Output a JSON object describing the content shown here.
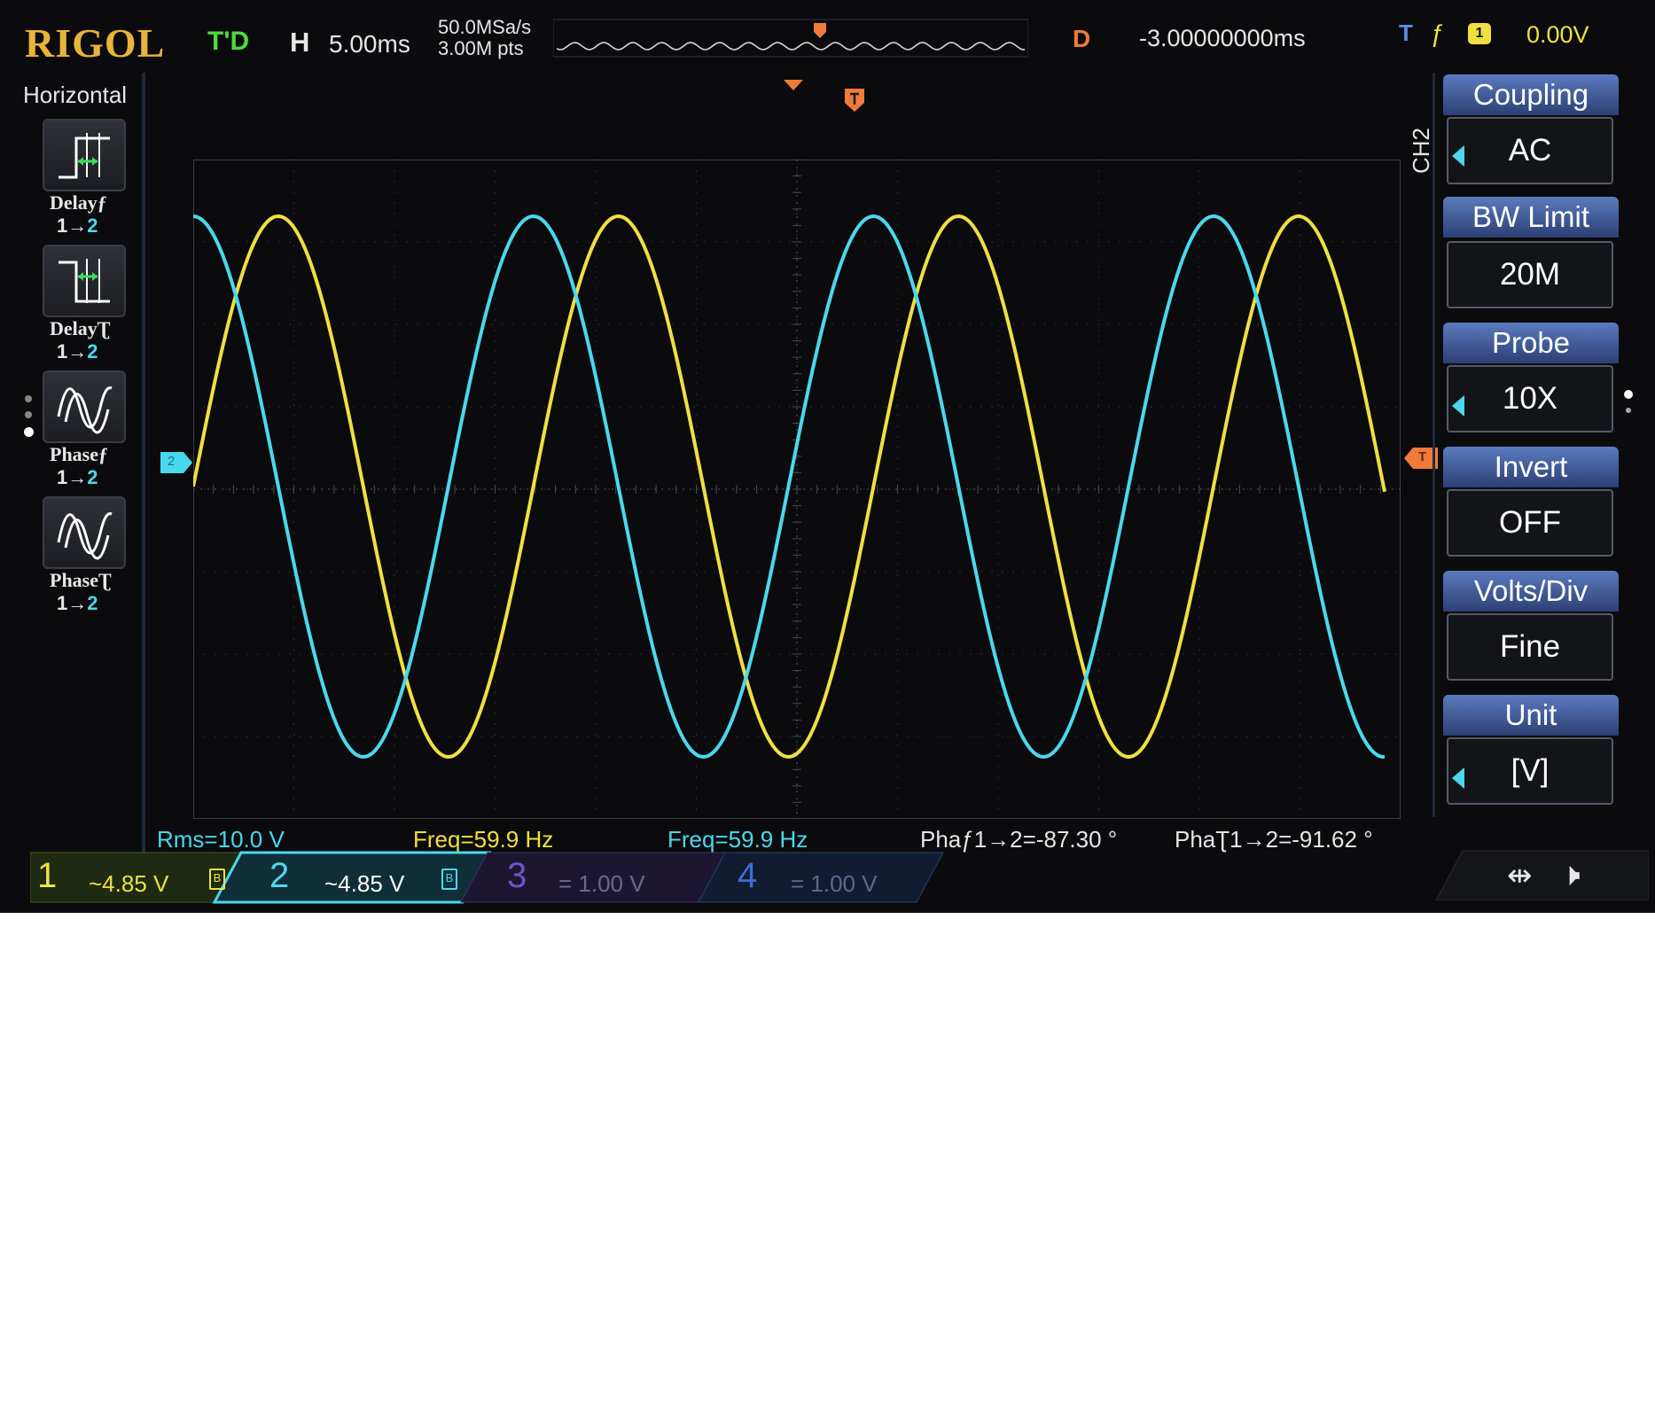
{
  "topbar": {
    "brand": "RIGOL",
    "run_state": "T'D",
    "horizontal_label": "H",
    "timebase": "5.00ms",
    "sample_rate": "50.0MSa/s",
    "memory_depth": "3.00M pts",
    "delay_label": "D",
    "delay_value": "-3.00000000ms",
    "trigger_label": "T",
    "trigger_source": "1",
    "trigger_level": "0.00V"
  },
  "left_menu": {
    "title": "Horizontal",
    "items": [
      {
        "label": "Delayƒ",
        "sub_a": "1→",
        "sub_b": "2"
      },
      {
        "label": "DelayƮ",
        "sub_a": "1→",
        "sub_b": "2"
      },
      {
        "label": "Phaseƒ",
        "sub_a": "1→",
        "sub_b": "2"
      },
      {
        "label": "PhaseƮ",
        "sub_a": "1→",
        "sub_b": "2"
      }
    ]
  },
  "right_menu": {
    "channel": "CH2",
    "items": [
      {
        "label": "Coupling",
        "value": "AC"
      },
      {
        "label": "BW Limit",
        "value": "20M"
      },
      {
        "label": "Probe",
        "value": "10X"
      },
      {
        "label": "Invert",
        "value": "OFF"
      },
      {
        "label": "Volts/Div",
        "value": "Fine"
      },
      {
        "label": "Unit",
        "value": "[V]"
      }
    ]
  },
  "markers": {
    "ch2_offset": "2",
    "trigger_level": "T"
  },
  "measurements": {
    "rms": "Rms=10.0 V",
    "freq1": "Freq=59.9 Hz",
    "freq2": "Freq=59.9 Hz",
    "phase_rise": "Phaƒ1→2=-87.30 °",
    "phase_fall": "PhaƮ1→2=-91.62 °"
  },
  "channels": [
    {
      "num": "1",
      "scale": "~4.85 V",
      "color": "#f0e040"
    },
    {
      "num": "2",
      "scale": "~4.85 V",
      "color": "#4ad8ee"
    },
    {
      "num": "3",
      "scale": "= 1.00 V",
      "color": "#6a56c8"
    },
    {
      "num": "4",
      "scale": "= 1.00 V",
      "color": "#3c6fd0"
    }
  ],
  "waveforms": {
    "ch1": {
      "color": "#f0e040",
      "cycles_on_screen": 3.55,
      "phase_deg_at_left": -90
    },
    "ch2": {
      "color": "#4ad8ee",
      "cycles_on_screen": 3.55,
      "phase_deg_at_left": 0
    }
  },
  "colors": {
    "ch1": "#f0e040",
    "ch2": "#4ad8ee",
    "menu_blue": "#3c5aa0",
    "trigger": "#f07a3a"
  }
}
